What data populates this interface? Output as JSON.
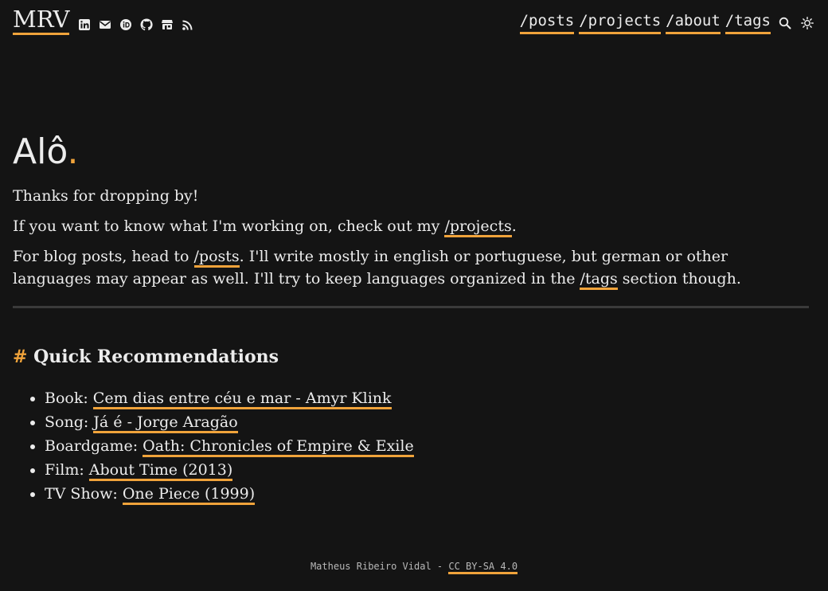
{
  "site": {
    "logo": "MRV",
    "socials": [
      {
        "icon": "linkedin-icon"
      },
      {
        "icon": "mail-icon"
      },
      {
        "icon": "orcid-icon"
      },
      {
        "icon": "github-icon"
      },
      {
        "icon": "store-icon"
      },
      {
        "icon": "rss-icon"
      }
    ],
    "nav": [
      "/posts",
      "/projects",
      "/about",
      "/tags"
    ],
    "nav_icons": [
      "search-icon",
      "theme-toggle-icon"
    ]
  },
  "colors": {
    "background": "#141414",
    "accent": "#f0a33b",
    "text": "#ececec"
  },
  "intro": {
    "heading": "Alô",
    "heading_dot": ".",
    "p1": "Thanks for dropping by!",
    "p2_before": "If you want to know what I'm working on, check out my ",
    "p2_link": "/projects",
    "p2_after": ".",
    "p3_before": "For blog posts, head to ",
    "p3_link1": "/posts",
    "p3_middle": ". I'll write mostly in english or portuguese, but german or other languages may appear as well. I'll try to keep languages organized in the ",
    "p3_link2": "/tags",
    "p3_after": " section though."
  },
  "recommendations": {
    "hash": "#",
    "title": "Quick Recommendations",
    "items": [
      {
        "label": "Book: ",
        "link": "Cem dias entre céu e mar - Amyr Klink"
      },
      {
        "label": "Song: ",
        "link": "Já é - Jorge Aragão"
      },
      {
        "label": "Boardgame: ",
        "link": "Oath: Chronicles of Empire & Exile"
      },
      {
        "label": "Film: ",
        "link": "About Time (2013)"
      },
      {
        "label": "TV Show: ",
        "link": "One Piece (1999)"
      }
    ]
  },
  "footer": {
    "author": "Matheus Ribeiro Vidal - ",
    "license": "CC BY-SA 4.0"
  }
}
